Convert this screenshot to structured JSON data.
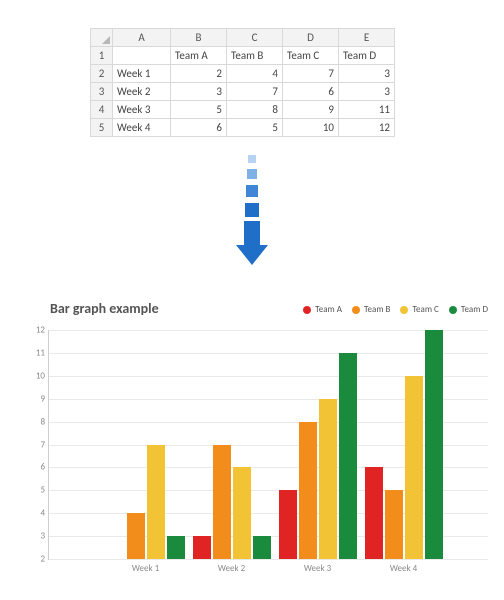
{
  "sheet": {
    "col_headers": [
      "A",
      "B",
      "C",
      "D",
      "E"
    ],
    "row_headers": [
      "1",
      "2",
      "3",
      "4",
      "5"
    ],
    "header_row": [
      "",
      "Team A",
      "Team B",
      "Team C",
      "Team D"
    ],
    "rows": [
      [
        "Week 1",
        "2",
        "4",
        "7",
        "3"
      ],
      [
        "Week 2",
        "3",
        "7",
        "6",
        "3"
      ],
      [
        "Week 3",
        "5",
        "8",
        "9",
        "11"
      ],
      [
        "Week 4",
        "6",
        "5",
        "10",
        "12"
      ]
    ]
  },
  "chart": {
    "title": "Bar graph example",
    "legend": [
      "Team A",
      "Team B",
      "Team C",
      "Team D"
    ],
    "colors": {
      "Team A": "#e02424",
      "Team B": "#f28c1b",
      "Team C": "#f2c335",
      "Team D": "#1a8a3d"
    },
    "ylim": [
      2,
      12
    ],
    "yticks": [
      2,
      3,
      4,
      5,
      6,
      7,
      8,
      9,
      10,
      11,
      12
    ]
  },
  "chart_data": {
    "type": "bar",
    "title": "Bar graph example",
    "xlabel": "",
    "ylabel": "",
    "ylim": [
      2,
      12
    ],
    "categories": [
      "Week 1",
      "Week 2",
      "Week 3",
      "Week 4"
    ],
    "series": [
      {
        "name": "Team A",
        "values": [
          2,
          3,
          5,
          6
        ]
      },
      {
        "name": "Team B",
        "values": [
          4,
          7,
          8,
          5
        ]
      },
      {
        "name": "Team C",
        "values": [
          7,
          6,
          9,
          10
        ]
      },
      {
        "name": "Team D",
        "values": [
          3,
          3,
          11,
          12
        ]
      }
    ],
    "legend_position": "top-right",
    "grid": true
  }
}
